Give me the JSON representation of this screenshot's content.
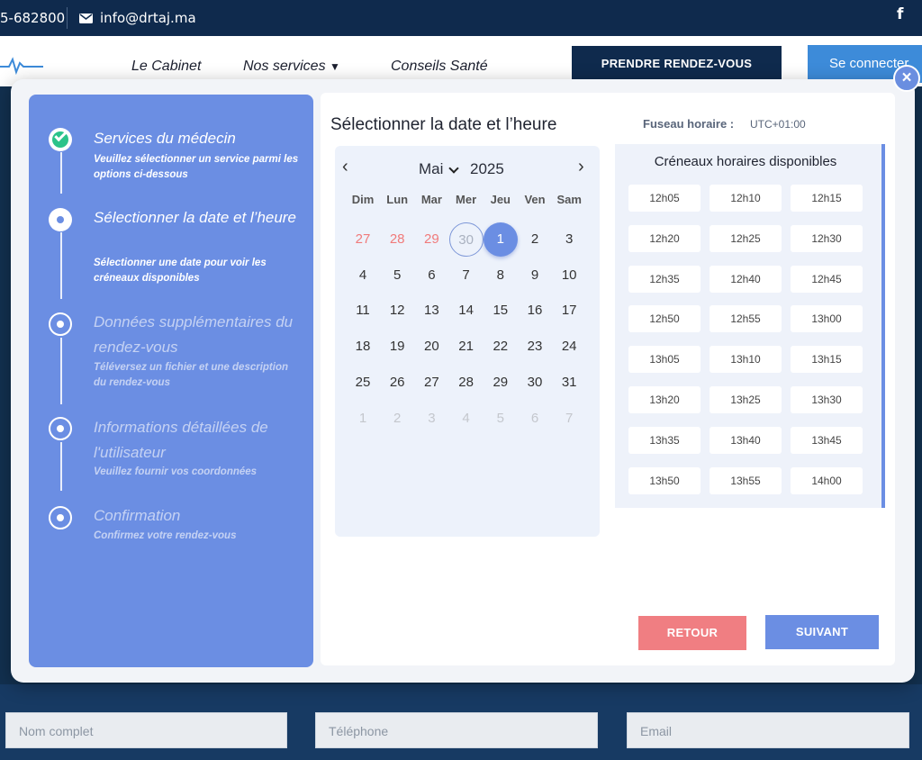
{
  "topbar": {
    "phone": "5-682800",
    "email": "info@drtaj.ma",
    "facebook_icon": "f"
  },
  "nav": {
    "links": [
      "Le Cabinet",
      "Nos services",
      "Conseils Santé"
    ],
    "cta": "PRENDRE RENDEZ-VOUS",
    "login": "Se connecter"
  },
  "background_form": {
    "name_placeholder": "Nom complet",
    "phone_placeholder": "Téléphone",
    "email_placeholder": "Email"
  },
  "modal": {
    "close_icon": "×",
    "steps": [
      {
        "title": "Services du médecin",
        "desc": "Veuillez sélectionner un service parmi les options ci-dessous",
        "state": "done"
      },
      {
        "title": "Sélectionner la date et l’heure",
        "desc": "Sélectionner une date pour voir les créneaux disponibles",
        "state": "active"
      },
      {
        "title": "Données supplémentaires du rendez-vous",
        "desc": "Téléversez un fichier et une description du rendez-vous",
        "state": "pending"
      },
      {
        "title": "Informations détaillées de l'utilisateur",
        "desc": "Veuillez fournir vos coordonnées",
        "state": "pending"
      },
      {
        "title": "Confirmation",
        "desc": "Confirmez votre rendez-vous",
        "state": "pending"
      }
    ],
    "section_title": "Sélectionner la date et l’heure",
    "timezone_label": "Fuseau horaire :",
    "timezone_value": "UTC+01:00",
    "calendar": {
      "month": "Mai",
      "year": "2025",
      "prev_icon": "‹",
      "next_icon": "›",
      "weekdays": [
        "Dim",
        "Lun",
        "Mar",
        "Mer",
        "Jeu",
        "Ven",
        "Sam"
      ],
      "weeks": [
        [
          "27",
          "28",
          "29",
          "30",
          "1",
          "2",
          "3"
        ],
        [
          "4",
          "5",
          "6",
          "7",
          "8",
          "9",
          "10"
        ],
        [
          "11",
          "12",
          "13",
          "14",
          "15",
          "16",
          "17"
        ],
        [
          "18",
          "19",
          "20",
          "21",
          "22",
          "23",
          "24"
        ],
        [
          "25",
          "26",
          "27",
          "28",
          "29",
          "30",
          "31"
        ],
        [
          "1",
          "2",
          "3",
          "4",
          "5",
          "6",
          "7"
        ]
      ],
      "selected": "1",
      "today": "30"
    },
    "slots_title": "Créneaux horaires disponibles",
    "slots": [
      "12h05",
      "12h10",
      "12h15",
      "12h20",
      "12h25",
      "12h30",
      "12h35",
      "12h40",
      "12h45",
      "12h50",
      "12h55",
      "13h00",
      "13h05",
      "13h10",
      "13h15",
      "13h20",
      "13h25",
      "13h30",
      "13h35",
      "13h40",
      "13h45",
      "13h50",
      "13h55",
      "14h00"
    ],
    "back_button": "RETOUR",
    "next_button": "SUIVANT",
    "colors": {
      "accent": "#6b8ee3",
      "back": "#f07e82",
      "done": "#2bc38a",
      "navy": "#0f2a4d"
    }
  }
}
